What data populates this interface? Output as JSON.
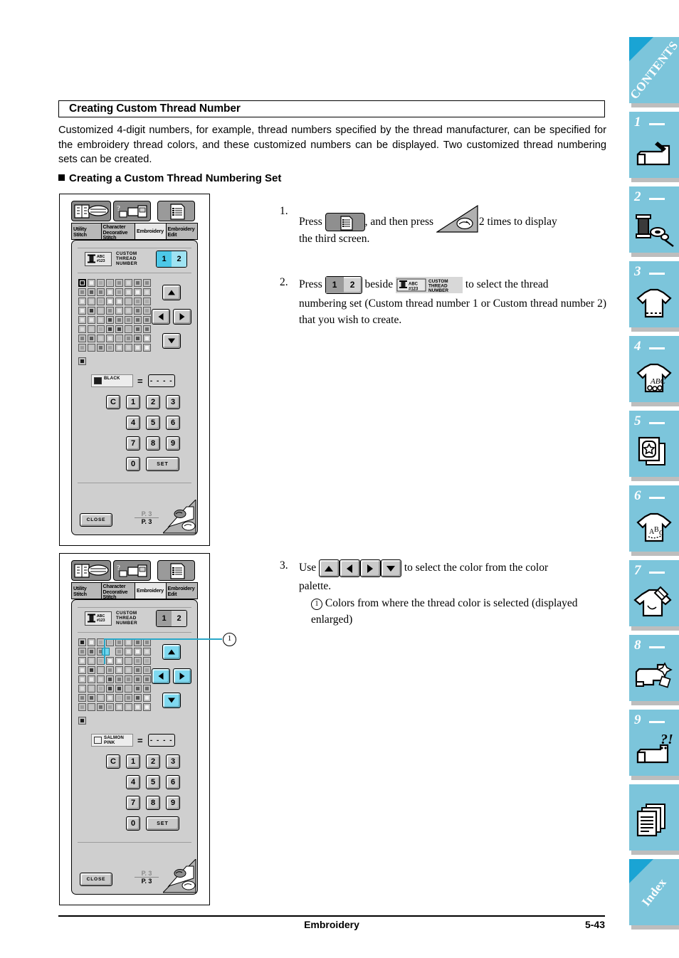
{
  "section": {
    "title": "Creating Custom Thread Number",
    "intro": "Customized 4-digit numbers, for example, thread numbers specified by the thread manufacturer, can be specified for the embroidery thread colors, and these customized numbers can be displayed. Two customized thread numbering sets can be created.",
    "subheading": "Creating a Custom Thread Numbering Set"
  },
  "steps": [
    {
      "number": "1.",
      "text_a": "Press",
      "text_b": ", and then press",
      "text_c": "2 times to display",
      "text_d": "the third screen."
    },
    {
      "number": "2.",
      "text_a": "Press",
      "toggle_1": "1",
      "toggle_2": "2",
      "text_b": "beside",
      "text_c": "to select the thread",
      "text_d": "numbering set (Custom thread number 1 or Custom thread number 2) that you wish to create."
    },
    {
      "number": "3.",
      "text_a": "Use",
      "text_b": "to select the color from the color",
      "text_c": "palette.",
      "callout_marker": "1",
      "callout_text": "Colors from where the thread color is selected (displayed enlarged)"
    }
  ],
  "screen": {
    "tab_labels": [
      "Utility\nStitch",
      "Character\nDecorative\nStitch",
      "Embroidery",
      "Embroidery\nEdit"
    ],
    "tab_icons": [
      "book-spool-icon",
      "question-machine-icon",
      "document-list-icon"
    ],
    "ctn": {
      "icon_name": "spool-abc123-icon",
      "icon_abc": "ABC",
      "icon_num": "#123",
      "label_line1": "CUSTOM",
      "label_line2": "THREAD",
      "label_line3": "NUMBER",
      "toggle_1": "1",
      "toggle_2": "2"
    },
    "nav_arrows": [
      "up-arrow",
      "left-arrow",
      "right-arrow",
      "down-arrow"
    ],
    "equals": "=",
    "value_placeholder": "- - - -",
    "keypad": [
      "C",
      "1",
      "2",
      "3",
      "4",
      "5",
      "6",
      "7",
      "8",
      "9",
      "0"
    ],
    "set_label": "SET",
    "close_label": "CLOSE",
    "page_indicator_top": "P. 3",
    "page_indicator_bottom": "P. 3"
  },
  "screen1": {
    "selected_color_name": "BLACK",
    "selected_color_hex": "#1c1c1c",
    "toggle_active": "1",
    "toggle_style": "cyan"
  },
  "screen2": {
    "selected_color_name_line1": "SALMON",
    "selected_color_name_line2": "PINK",
    "selected_color_hex": "#f0f0f0",
    "toggle_active": "1",
    "toggle_style": "grey",
    "callout_number": "1"
  },
  "palette": {
    "rows": 8,
    "cols": 8,
    "grid": [
      [
        "#1c1c1c",
        "#efefef",
        "#a8a8a8",
        "#b5b5b5",
        "#8e8e8e",
        "#d8d8d8",
        "#6e6e6e",
        "#8a8a8a"
      ],
      [
        "#888888",
        "#5b5b5b",
        "#7d7d7d",
        "#e8e8e8",
        "#9b9b9b",
        "#e0e0e0",
        "#f2f2f2",
        "#dcdcdc"
      ],
      [
        "#e4e4e4",
        "#cfcfcf",
        "#b0b0b0",
        "#f4f4f4",
        "#e8e8e8",
        "#c2c2c2",
        "#9a9a9a",
        "#adadad"
      ],
      [
        "#eaeaea",
        "#3a3a3a",
        "#c6c6c6",
        "#8b8b8b",
        "#dedede",
        "#cdcdcd",
        "#707070",
        "#9f9f9f"
      ],
      [
        "#e2e2e2",
        "#e6e6e6",
        "#d4d4d4",
        "#4a4a4a",
        "#7a7a7a",
        "#8f8f8f",
        "#6b6b6b",
        "#757575"
      ],
      [
        "#dadada",
        "#c8c8c8",
        "#ababab",
        "#3d3d3d",
        "#424242",
        "#b9b9b9",
        "#5f5f5f",
        "#6a6a6a"
      ],
      [
        "#7e7e7e",
        "#595959",
        "#cacaca",
        "#e3e3e3",
        "#b4b4b4",
        "#8c8c8c",
        "#525252",
        "#f0f0f0"
      ],
      [
        "#9e9e9e",
        "#c4c4c4",
        "#6d6d6d",
        "#a2a2a2",
        "#dddddd",
        "#cfcfcf",
        "#e9e9e9",
        "#f5f5f5"
      ]
    ],
    "extra_cell_hex": "#1c1c1c"
  },
  "sidetabs": [
    {
      "label": "CONTENTS",
      "type": "text",
      "icon": "contents-tab"
    },
    {
      "label": "1",
      "type": "num",
      "icon": "sewing-machine-icon"
    },
    {
      "label": "2",
      "type": "num",
      "icon": "spool-thread-icon"
    },
    {
      "label": "3",
      "type": "num",
      "icon": "tshirt-stitch-icon"
    },
    {
      "label": "4",
      "type": "num",
      "icon": "tshirt-abc-icon"
    },
    {
      "label": "5",
      "type": "num",
      "icon": "hoop-star-icon"
    },
    {
      "label": "6",
      "type": "num",
      "icon": "tshirt-letters-icon"
    },
    {
      "label": "7",
      "type": "num",
      "icon": "tshirt-pen-icon"
    },
    {
      "label": "8",
      "type": "num",
      "icon": "machine-clean-icon"
    },
    {
      "label": "9",
      "type": "num",
      "icon": "machine-question-icon"
    },
    {
      "label": "",
      "type": "plain",
      "icon": "pages-icon"
    },
    {
      "label": "Index",
      "type": "text",
      "icon": "index-tab"
    }
  ],
  "footer": {
    "center": "Embroidery",
    "page": "5-43"
  },
  "colors": {
    "tab_blue": "#7cc5db",
    "tab_corner_blue": "#1aa4d4",
    "highlight_cyan": "#4dc8e8",
    "callout_line": "#2aa8c9",
    "lcd_panel": "#cfcfcf"
  }
}
